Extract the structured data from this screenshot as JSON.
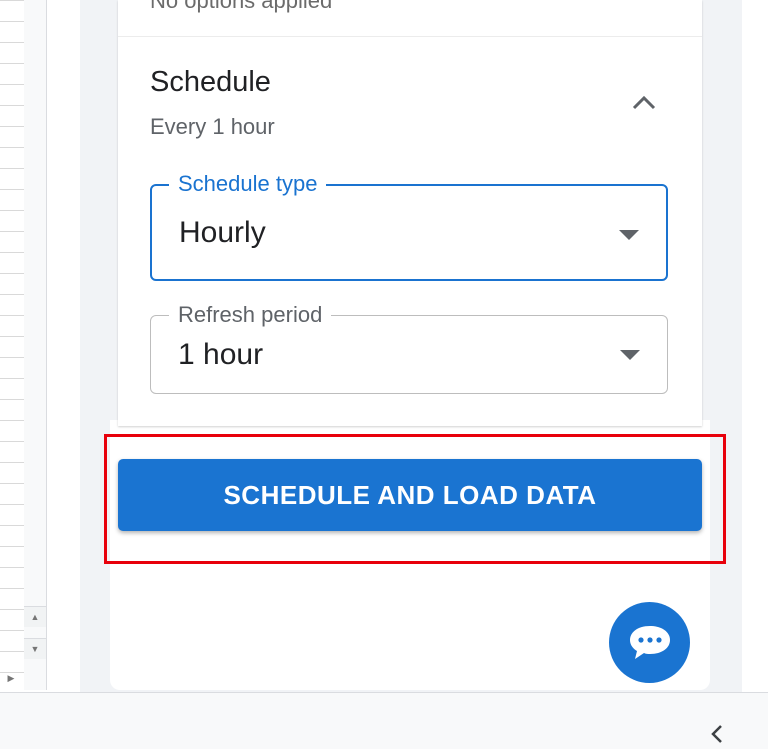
{
  "panel": {
    "previous_summary": "No options applied",
    "schedule": {
      "title": "Schedule",
      "subtitle": "Every 1 hour",
      "collapse_icon": "chevron-up-icon"
    },
    "schedule_type": {
      "label": "Schedule type",
      "value": "Hourly",
      "state": "focused"
    },
    "refresh_period": {
      "label": "Refresh period",
      "value": "1 hour"
    },
    "primary_action": {
      "label": "SCHEDULE AND LOAD DATA"
    },
    "chat_icon": "chat-bubble-icon"
  },
  "colors": {
    "primary": "#1a74d1",
    "highlight": "#e8000b",
    "panel_background": "#f1f3f6"
  },
  "footer": {
    "collapse_icon": "chevron-left-icon"
  }
}
